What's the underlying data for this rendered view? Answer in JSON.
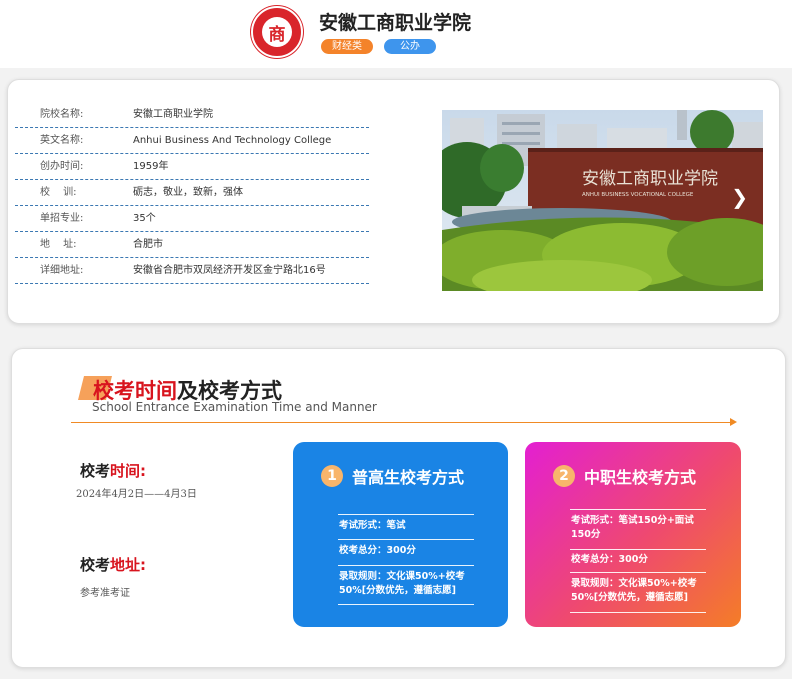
{
  "header": {
    "title": "安徽工商职业学院",
    "logo_text": "商",
    "tags": [
      "财经类",
      "公办"
    ]
  },
  "info": {
    "rows": [
      {
        "key": "院校名称:",
        "value": "安徽工商职业学院"
      },
      {
        "key": "英文名称:",
        "value": "Anhui Business And Technology College"
      },
      {
        "key": "创办时间:",
        "value": "1959年"
      },
      {
        "key": "校　 训:",
        "value": "砺志，敬业，致新，强体"
      },
      {
        "key": "单招专业:",
        "value": "35个"
      },
      {
        "key": "地　 址:",
        "value": "合肥市"
      },
      {
        "key": "详细地址:",
        "value": "安徽省合肥市双凤经济开发区金宁路北16号"
      }
    ],
    "photo": {
      "sign_text": "安徽工商职业学院",
      "sign_sub": "ANHUI BUSINESS VOCATIONAL COLLEGE",
      "next_icon": "chevron-right-icon"
    }
  },
  "exam": {
    "title_red": "校考时间",
    "title_rest": "及校考方式",
    "subtitle": "School Entrance Examination Time and Manner",
    "time_label_black": "校考",
    "time_label_red": "时间:",
    "date": "2024年4月2日——4月3日",
    "addr_label_black": "校考",
    "addr_label_red": "地址:",
    "addr": "参考准考证",
    "boxes": [
      {
        "num": "1",
        "title": "普高生校考方式",
        "items": [
          "考试形式：笔试",
          "校考总分：300分",
          "录取规则：文化课50%+校考50%[分数优先，遵循志愿]"
        ]
      },
      {
        "num": "2",
        "title": "中职生校考方式",
        "items": [
          "考试形式：笔试150分+面试150分",
          "校考总分：300分",
          "录取规则：文化课50%+校考50%[分数优先，遵循志愿]"
        ]
      }
    ]
  },
  "colors": {
    "accent_red": "#d8141e",
    "tag_orange": "#f4832a",
    "tag_blue": "#3e95ed",
    "box_blue": "#1a84e5",
    "rule_orange": "#f08a24"
  }
}
